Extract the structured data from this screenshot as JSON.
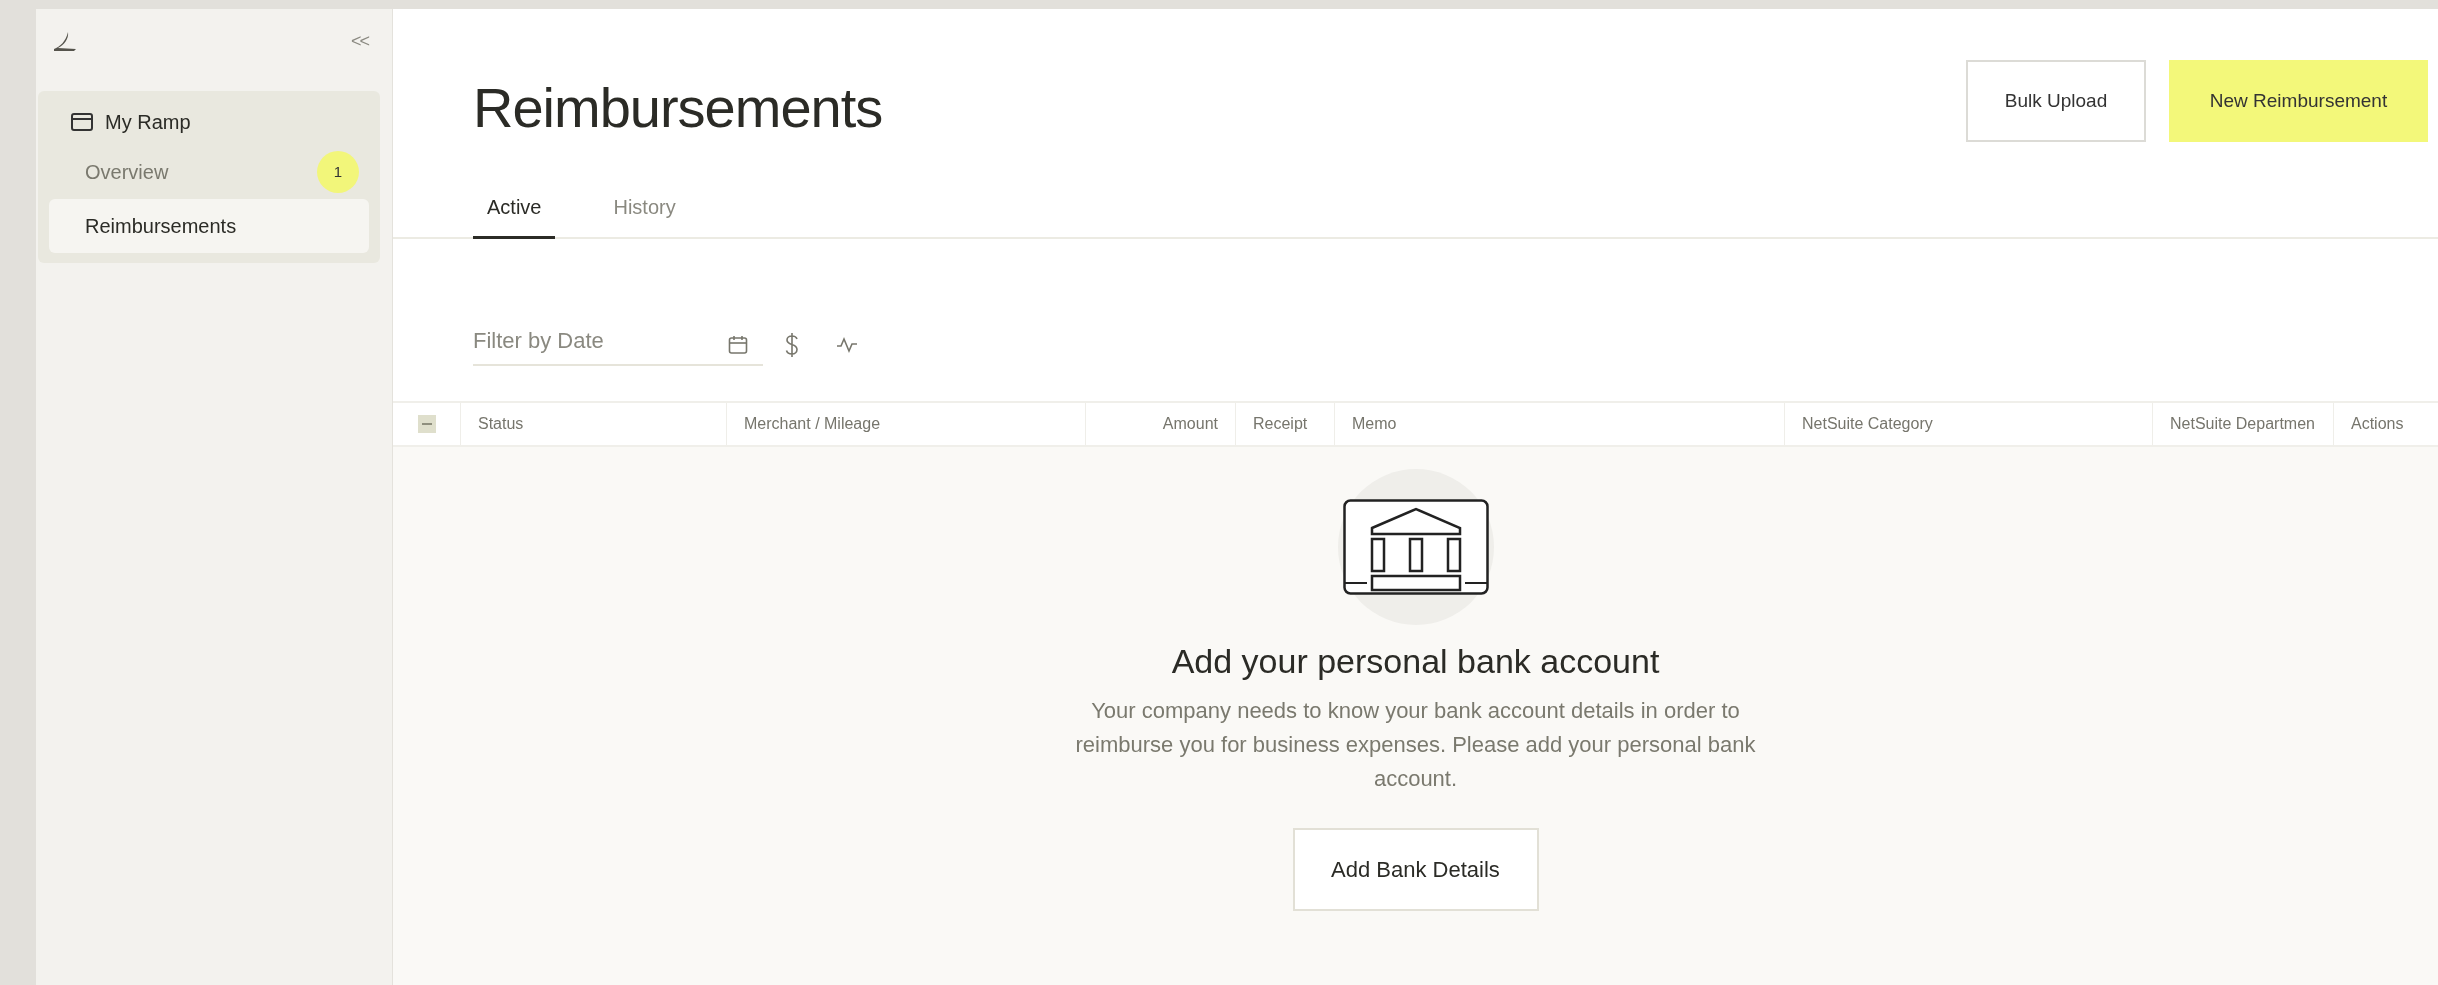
{
  "sidebar": {
    "collapse_label": "<<",
    "group": {
      "label": "My Ramp",
      "items": [
        {
          "label": "Overview",
          "badge": "1",
          "selected": false
        },
        {
          "label": "Reimbursements",
          "selected": true
        }
      ]
    }
  },
  "page": {
    "title": "Reimbursements",
    "buttons": [
      {
        "label": "Bulk Upload",
        "kind": "outline"
      },
      {
        "label": "New Reimbursement",
        "kind": "primary"
      }
    ]
  },
  "tabs": [
    {
      "label": "Active",
      "selected": true
    },
    {
      "label": "History",
      "selected": false
    }
  ],
  "filter": {
    "placeholder": "Filter by Date"
  },
  "table": {
    "select_all": {
      "indeterminate": true
    },
    "columns": [
      {
        "label": "Status",
        "kind": "text"
      },
      {
        "label": "Merchant / Mileage",
        "kind": "text"
      },
      {
        "label": "Amount",
        "kind": "number"
      },
      {
        "label": "Receipt",
        "kind": "text"
      },
      {
        "label": "Memo",
        "kind": "text"
      },
      {
        "label": "NetSuite Category",
        "kind": "text"
      },
      {
        "label": "NetSuite Departmen",
        "kind": "text"
      },
      {
        "label": "Actions",
        "kind": "text"
      }
    ]
  },
  "empty_state": {
    "title": "Add your personal bank account",
    "message": "Your company needs to know your bank account details in order to reimburse you for business expenses. Please add your personal bank account.",
    "button": "Add Bank Details"
  }
}
